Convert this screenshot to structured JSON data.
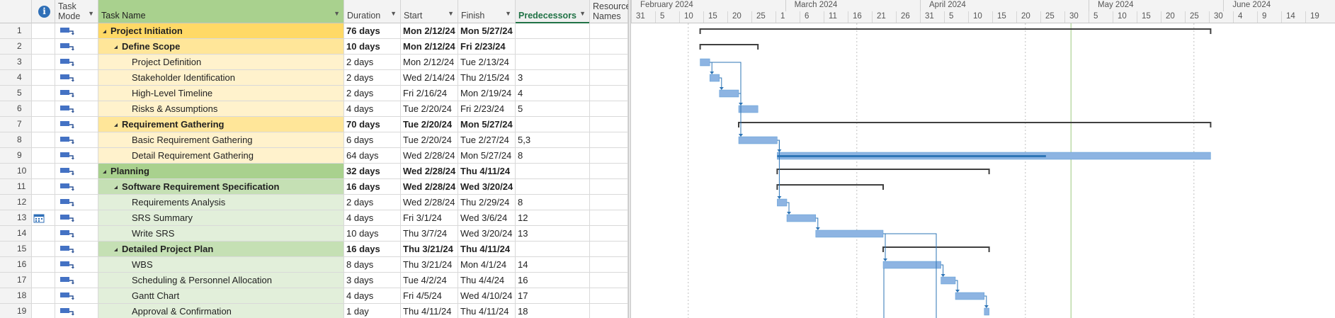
{
  "columns": {
    "info_icon": "information-icon",
    "task_mode": "Task Mode",
    "task_name": "Task Name",
    "duration": "Duration",
    "start": "Start",
    "finish": "Finish",
    "predecessors": "Predecessors",
    "resource_names": "Resource Names"
  },
  "timeline": {
    "months": [
      "February 2024",
      "March 2024",
      "April 2024",
      "May 2024",
      "June 2024"
    ],
    "days": [
      "31",
      "5",
      "10",
      "15",
      "20",
      "25",
      "1",
      "6",
      "11",
      "16",
      "21",
      "26",
      "31",
      "5",
      "10",
      "15",
      "20",
      "25",
      "30",
      "5",
      "10",
      "15",
      "20",
      "25",
      "30",
      "4",
      "9",
      "14",
      "19"
    ]
  },
  "tasks": [
    {
      "id": "1",
      "name": "Project Initiation",
      "duration": "76 days",
      "start": "Mon 2/12/24",
      "finish": "Mon 5/27/24",
      "pred": "",
      "type": "l1"
    },
    {
      "id": "2",
      "name": "Define Scope",
      "duration": "10 days",
      "start": "Mon 2/12/24",
      "finish": "Fri 2/23/24",
      "pred": "",
      "type": "l2"
    },
    {
      "id": "3",
      "name": "Project Definition",
      "duration": "2 days",
      "start": "Mon 2/12/24",
      "finish": "Tue 2/13/24",
      "pred": "",
      "type": "l3"
    },
    {
      "id": "4",
      "name": "Stakeholder Identification",
      "duration": "2 days",
      "start": "Wed 2/14/24",
      "finish": "Thu 2/15/24",
      "pred": "3",
      "type": "l3"
    },
    {
      "id": "5",
      "name": "High-Level Timeline",
      "duration": "2 days",
      "start": "Fri 2/16/24",
      "finish": "Mon 2/19/24",
      "pred": "4",
      "type": "l3"
    },
    {
      "id": "6",
      "name": "Risks & Assumptions",
      "duration": "4 days",
      "start": "Tue 2/20/24",
      "finish": "Fri 2/23/24",
      "pred": "5",
      "type": "l3"
    },
    {
      "id": "7",
      "name": "Requirement Gathering",
      "duration": "70 days",
      "start": "Tue 2/20/24",
      "finish": "Mon 5/27/24",
      "pred": "",
      "type": "l2"
    },
    {
      "id": "8",
      "name": "Basic Requirement Gathering",
      "duration": "6 days",
      "start": "Tue 2/20/24",
      "finish": "Tue 2/27/24",
      "pred": "5,3",
      "type": "l3"
    },
    {
      "id": "9",
      "name": "Detail Requirement Gathering",
      "duration": "64 days",
      "start": "Wed 2/28/24",
      "finish": "Mon 5/27/24",
      "pred": "8",
      "type": "l3"
    },
    {
      "id": "10",
      "name": "Planning",
      "duration": "32 days",
      "start": "Wed 2/28/24",
      "finish": "Thu 4/11/24",
      "pred": "",
      "type": "g1"
    },
    {
      "id": "11",
      "name": "Software Requirement Specification",
      "duration": "16 days",
      "start": "Wed 2/28/24",
      "finish": "Wed 3/20/24",
      "pred": "",
      "type": "g2"
    },
    {
      "id": "12",
      "name": "Requirements Analysis",
      "duration": "2 days",
      "start": "Wed 2/28/24",
      "finish": "Thu 2/29/24",
      "pred": "8",
      "type": "g3"
    },
    {
      "id": "13",
      "name": "SRS Summary",
      "duration": "4 days",
      "start": "Fri 3/1/24",
      "finish": "Wed 3/6/24",
      "pred": "12",
      "type": "g3",
      "indicator": "calendar-icon"
    },
    {
      "id": "14",
      "name": "Write SRS",
      "duration": "10 days",
      "start": "Thu 3/7/24",
      "finish": "Wed 3/20/24",
      "pred": "13",
      "type": "g3"
    },
    {
      "id": "15",
      "name": "Detailed Project Plan",
      "duration": "16 days",
      "start": "Thu 3/21/24",
      "finish": "Thu 4/11/24",
      "pred": "",
      "type": "g2"
    },
    {
      "id": "16",
      "name": "WBS",
      "duration": "8 days",
      "start": "Thu 3/21/24",
      "finish": "Mon 4/1/24",
      "pred": "14",
      "type": "g3"
    },
    {
      "id": "17",
      "name": "Scheduling & Personnel Allocation",
      "duration": "3 days",
      "start": "Tue 4/2/24",
      "finish": "Thu 4/4/24",
      "pred": "16",
      "type": "g3"
    },
    {
      "id": "18",
      "name": "Gantt Chart",
      "duration": "4 days",
      "start": "Fri 4/5/24",
      "finish": "Wed 4/10/24",
      "pred": "17",
      "type": "g3"
    },
    {
      "id": "19",
      "name": "Approval & Confirmation",
      "duration": "1 day",
      "start": "Thu 4/11/24",
      "finish": "Thu 4/11/24",
      "pred": "18",
      "type": "g3"
    }
  ],
  "colors": {
    "bar": "#8db4e2",
    "bar_edge": "#5b9bd5",
    "summary": "#404040",
    "link": "#2e75b6",
    "today_line": "#9bc77c"
  }
}
